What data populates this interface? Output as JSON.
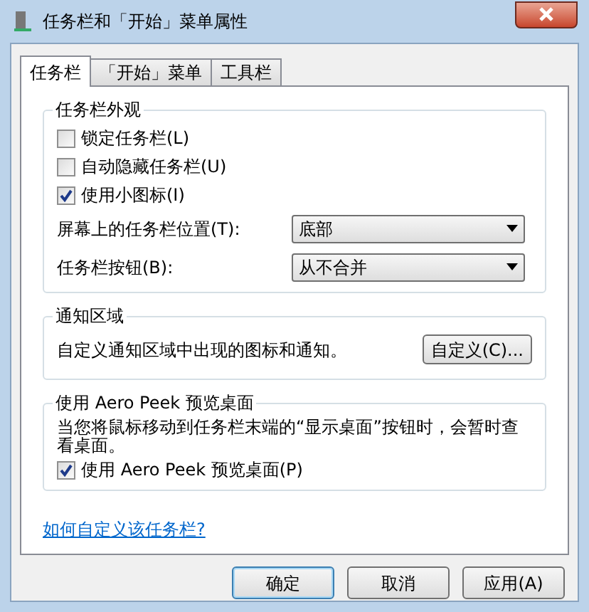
{
  "window": {
    "title": "任务栏和「开始」菜单属性"
  },
  "tabs": [
    {
      "label": "任务栏",
      "selected": true
    },
    {
      "label": "「开始」菜单",
      "selected": false
    },
    {
      "label": "工具栏",
      "selected": false
    }
  ],
  "appearance": {
    "title": "任务栏外观",
    "checkboxes": [
      {
        "label": "锁定任务栏(L)",
        "checked": false
      },
      {
        "label": "自动隐藏任务栏(U)",
        "checked": false
      },
      {
        "label": "使用小图标(I)",
        "checked": true
      }
    ],
    "dropdowns": [
      {
        "label": "屏幕上的任务栏位置(T):",
        "value": "底部"
      },
      {
        "label": "任务栏按钮(B):",
        "value": "从不合并"
      }
    ]
  },
  "notification": {
    "title": "通知区域",
    "description": "自定义通知区域中出现的图标和通知。",
    "button": "自定义(C)..."
  },
  "aero_peek": {
    "title": "使用 Aero Peek 预览桌面",
    "description": "当您将鼠标移动到任务栏末端的“显示桌面”按钮时，会暂时查看桌面。",
    "checkbox": {
      "label": "使用 Aero Peek 预览桌面(P)",
      "checked": true
    }
  },
  "help_link": "如何自定义该任务栏?",
  "buttons": [
    {
      "label": "确定",
      "default": true
    },
    {
      "label": "取消",
      "default": false
    },
    {
      "label": "应用(A)",
      "default": false
    }
  ]
}
